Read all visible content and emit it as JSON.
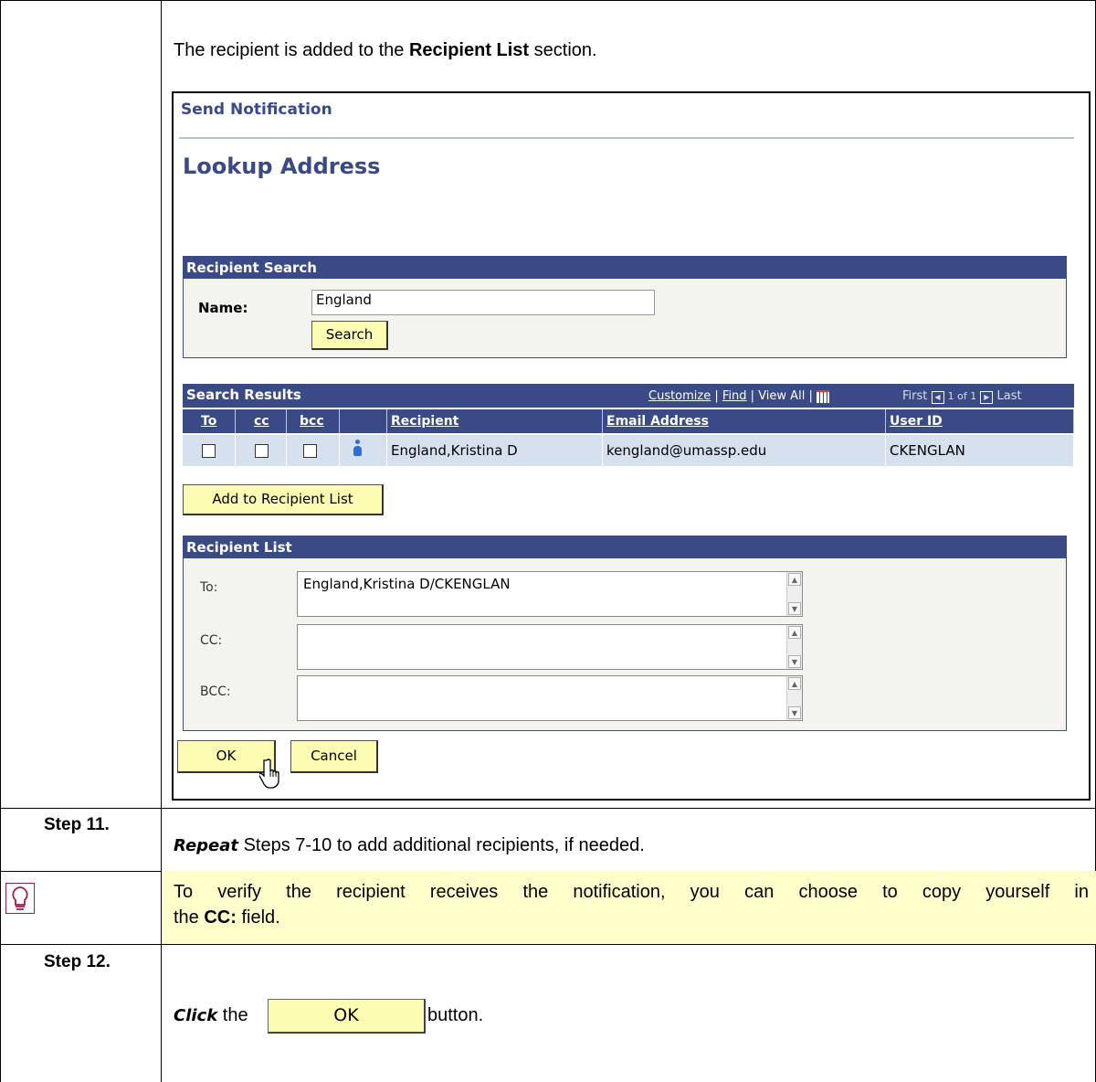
{
  "intro": {
    "prefix": "The recipient is added to the ",
    "bold": "Recipient List",
    "suffix": " section."
  },
  "screenshot": {
    "breadcrumb": "Send Notification",
    "title": "Lookup Address",
    "recipient_search": {
      "header": "Recipient Search",
      "name_label": "Name:",
      "name_value": "England",
      "search_button": "Search"
    },
    "search_results": {
      "header": "Search Results",
      "customize": "Customize",
      "find": "Find",
      "view_all": "View All",
      "first": "First",
      "page_info": "1 of 1",
      "last": "Last",
      "columns": [
        "To",
        "cc",
        "bcc",
        "",
        "Recipient",
        "Email Address",
        "User ID"
      ],
      "rows": [
        {
          "recipient": "England,Kristina D",
          "email": "kengland@umassp.edu",
          "user_id": "CKENGLAN"
        }
      ]
    },
    "add_button": "Add to Recipient List",
    "recipient_list": {
      "header": "Recipient List",
      "to_label": "To:",
      "to_value": "England,Kristina D/CKENGLAN",
      "cc_label": "CC:",
      "cc_value": "",
      "bcc_label": "BCC:",
      "bcc_value": ""
    },
    "ok_button": "OK",
    "cancel_button": "Cancel"
  },
  "step11": {
    "label": "Step 11.",
    "action": "Repeat",
    "text": " Steps 7-10 to add additional recipients, if needed."
  },
  "tip": {
    "line1": "To verify the recipient receives the notification, you can choose to copy yourself in",
    "line2_prefix": "the ",
    "line2_bold": "CC:",
    "line2_suffix": " field."
  },
  "step12": {
    "label": "Step 12.",
    "action": "Click",
    "the": " the ",
    "button_label": "OK",
    "suffix": " button."
  },
  "colors": {
    "header_blue": "#3a4a84",
    "button_yellow": "#fcfcb3",
    "row_blue": "#d6e0ef",
    "tip_yellow": "#ffffcc"
  }
}
